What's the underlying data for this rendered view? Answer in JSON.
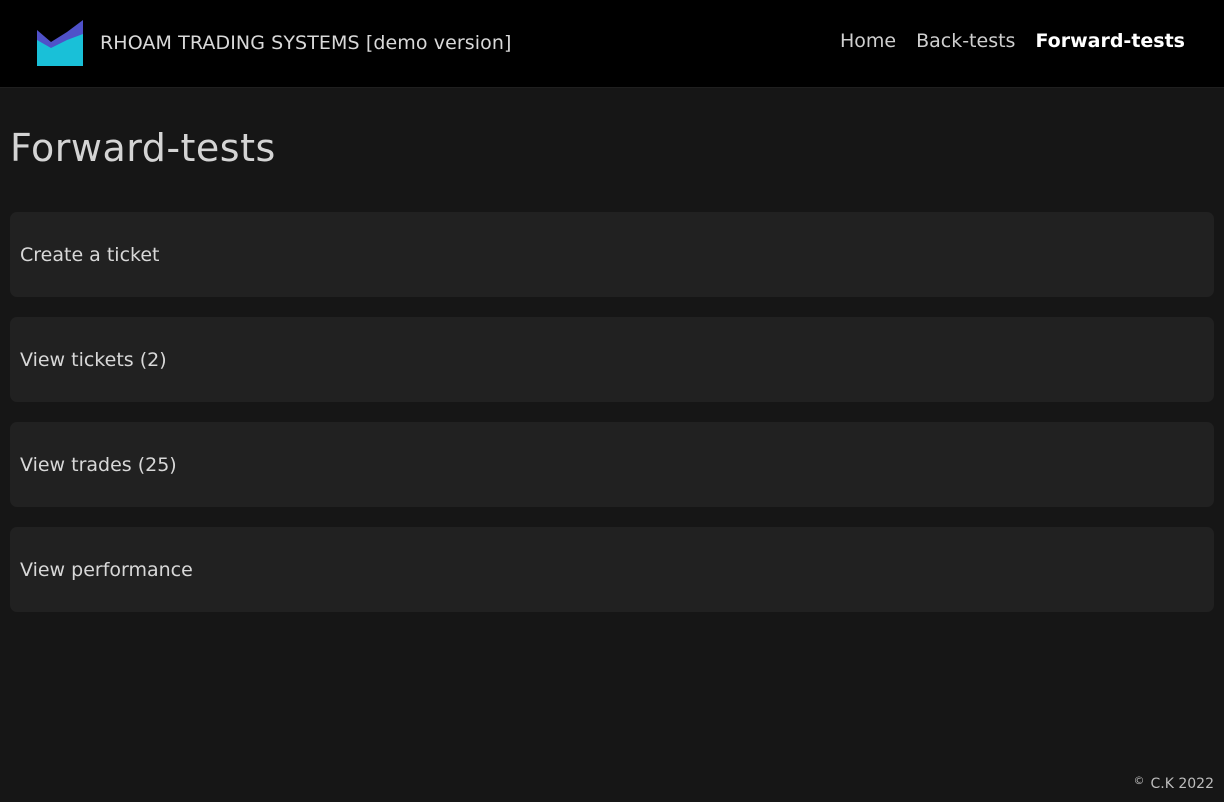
{
  "header": {
    "brand_text": "RHOAM TRADING SYSTEMS [demo version]",
    "logo_icon": "area-chart-logo",
    "nav": [
      {
        "label": "Home",
        "active": false
      },
      {
        "label": "Back-tests",
        "active": false
      },
      {
        "label": "Forward-tests",
        "active": true
      }
    ]
  },
  "main": {
    "title": "Forward-tests",
    "cards": [
      {
        "label": "Create a ticket"
      },
      {
        "label": "View tickets (2)"
      },
      {
        "label": "View trades (25)"
      },
      {
        "label": "View performance"
      }
    ]
  },
  "footer": {
    "copyright_symbol": "©",
    "text": "C.K 2022"
  },
  "colors": {
    "background": "#161616",
    "navbar": "#000000",
    "card": "#212121",
    "logo_top": "#4f51c9",
    "logo_bottom": "#19c0d8"
  }
}
